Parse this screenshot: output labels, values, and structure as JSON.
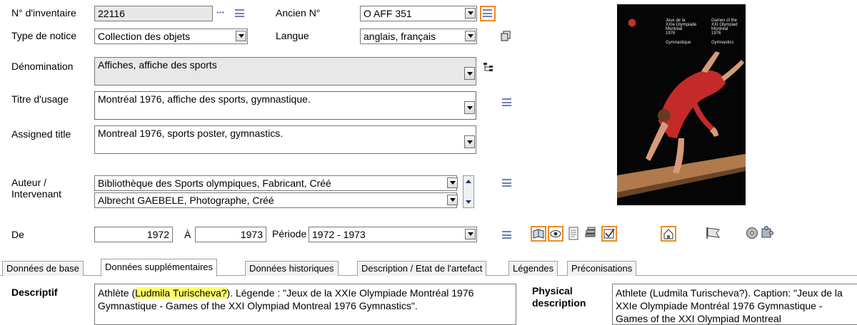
{
  "form": {
    "inventaire": {
      "label": "N° d'inventaire",
      "value": "22116"
    },
    "ancien": {
      "label": "Ancien N°",
      "value": "O AFF 351"
    },
    "type_notice": {
      "label": "Type de notice",
      "value": "Collection des objets"
    },
    "langue": {
      "label": "Langue",
      "value": "anglais, français"
    },
    "denomination": {
      "label": "Dénomination",
      "value": "Affiches, affiche des sports"
    },
    "titre_usage": {
      "label": "Titre d'usage",
      "value": "Montréal 1976, affiche des sports, gymnastique."
    },
    "assigned_title": {
      "label": "Assigned title",
      "value": "Montreal 1976, sports poster, gymnastics."
    },
    "auteur": {
      "label_line1": "Auteur /",
      "label_line2": "Intervenant",
      "entries": [
        "Bibliothèque des Sports olympiques, Fabricant, Créé",
        "Albrecht GAEBELE, Photographe, Créé"
      ]
    },
    "de": {
      "label": "De",
      "value": "1972"
    },
    "a": {
      "label": "À",
      "value": "1973"
    },
    "periode": {
      "label": "Période",
      "value": "1972 - 1973"
    }
  },
  "poster": {
    "text_left": [
      "Jeux de la",
      "XXIe Olympiade",
      "Montréal",
      "1976"
    ],
    "text_right": [
      "Games of the",
      "XXI Olympiad",
      "Montreal",
      "1976"
    ],
    "caption_left": "Gymnastique",
    "caption_right": "Gymnastics"
  },
  "tabs": [
    "Données de base",
    "Données supplémentaires",
    "Données historiques",
    "Description / Etat de l'artefact",
    "Légendes",
    "Préconisations"
  ],
  "active_tab": 1,
  "descriptif": {
    "label": "Descriptif",
    "text_before": "Athlète (",
    "text_highlight": "Ludmila Turischeva?",
    "text_after": "). Légende : \"Jeux de la XXIe Olympiade Montréal 1976 Gymnastique - Games of the XXI Olympiad Montreal 1976 Gymnastics\"."
  },
  "physical": {
    "label_line1": "Physical",
    "label_line2": "description",
    "text": "Athlete (Ludmila Turischeva?). Caption: \"Jeux de la XXIe Olympiade Montréal 1976 Gymnastique - Games of the XXI Olympiad Montreal"
  },
  "icons": {
    "ellipsis": "ellipsis-icon",
    "list": "list-icon",
    "copy": "copy-icon",
    "hierarchy": "hierarchy-icon",
    "accent": "#f08a24"
  }
}
